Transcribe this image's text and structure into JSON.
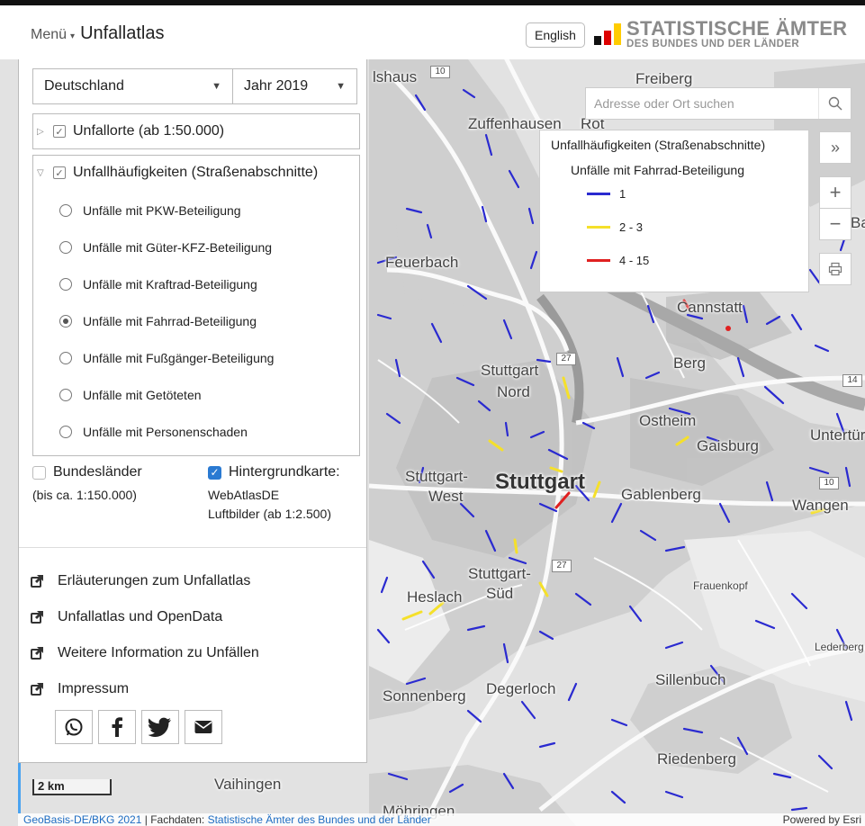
{
  "header": {
    "menu_label": "Menü",
    "title": "Unfallatlas",
    "language_button": "English",
    "logo_line1": "STATISTISCHE ÄMTER",
    "logo_line2": "DES BUNDES UND DER LÄNDER"
  },
  "panel": {
    "region_select": "Deutschland",
    "year_select": "Jahr 2019",
    "layer_unfallorte": "Unfallorte (ab 1:50.000)",
    "layer_haeufigkeiten": "Unfallhäufigkeiten (Straßenabschnitte)",
    "radio_options": [
      "Unfälle mit PKW-Beteiligung",
      "Unfälle mit Güter-KFZ-Beteiligung",
      "Unfälle mit Kraftrad-Beteiligung",
      "Unfälle mit Fahrrad-Beteiligung",
      "Unfälle mit Fußgänger-Beteiligung",
      "Unfälle mit Getöteten",
      "Unfälle mit Personenschaden"
    ],
    "selected_radio_index": 3,
    "bundeslaender_label": "Bundesländer",
    "bundeslaender_sub": "(bis ca. 1:150.000)",
    "bundeslaender_checked": false,
    "hintergrund_label": "Hintergrundkarte:",
    "hintergrund_line1": "WebAtlasDE",
    "hintergrund_line2": "Luftbilder (ab 1:2.500)",
    "hintergrund_checked": true,
    "links": [
      "Erläuterungen zum Unfallatlas",
      "Unfallatlas und OpenData",
      "Weitere Information zu Unfällen",
      "Impressum"
    ],
    "share_icons": [
      "whatsapp-icon",
      "facebook-icon",
      "twitter-icon",
      "mail-icon"
    ]
  },
  "map": {
    "search_placeholder": "Adresse oder Ort suchen",
    "legend": {
      "title": "Unfallhäufigkeiten (Straßenabschnitte)",
      "subtitle": "Unfälle mit Fahrrad-Beteiligung",
      "classes": [
        {
          "label": "1",
          "color": "#2a2ad0"
        },
        {
          "label": "2 - 3",
          "color": "#f5e02a"
        },
        {
          "label": "4 - 15",
          "color": "#e02020"
        }
      ]
    },
    "place_labels": {
      "stuttgart": "Stuttgart",
      "feuerbach": "Feuerbach",
      "zuffenhausen": "Zuffenhausen",
      "freiberg": "Freiberg",
      "cannstatt": "Cannstatt",
      "berg": "Berg",
      "stuttgart_nord_1": "Stuttgart",
      "stuttgart_nord_2": "Nord",
      "ostheim": "Ostheim",
      "gaisburg": "Gaisburg",
      "untertuerkheim": "Untertür",
      "stuttgart_west_1": "Stuttgart-",
      "stuttgart_west_2": "West",
      "gablenberg": "Gablenberg",
      "wangen": "Wangen",
      "stuttgart_sued_1": "Stuttgart-",
      "stuttgart_sued_2": "Süd",
      "heslach": "Heslach",
      "frauenkopf": "Frauenkopf",
      "lederberg": "Lederberg",
      "sonnenberg": "Sonnenberg",
      "degerloch": "Degerloch",
      "sillenbuch": "Sillenbuch",
      "riedenberg": "Riedenberg",
      "vaihingen": "Vaihingen",
      "moehringen": "Möhringen",
      "rot": "Rot",
      "lshaus": "lshaus",
      "bad_partial": "Ba"
    },
    "road_shields": [
      "10",
      "27",
      "27",
      "14",
      "10"
    ],
    "scale_label": "2 km",
    "attribution_prefix": "GeoBasis-DE/BKG 2021",
    "attribution_middle": " | Fachdaten: ",
    "attribution_link": "Statistische Ämter des Bundes und der Länder",
    "powered_by": "Powered by Esri"
  }
}
